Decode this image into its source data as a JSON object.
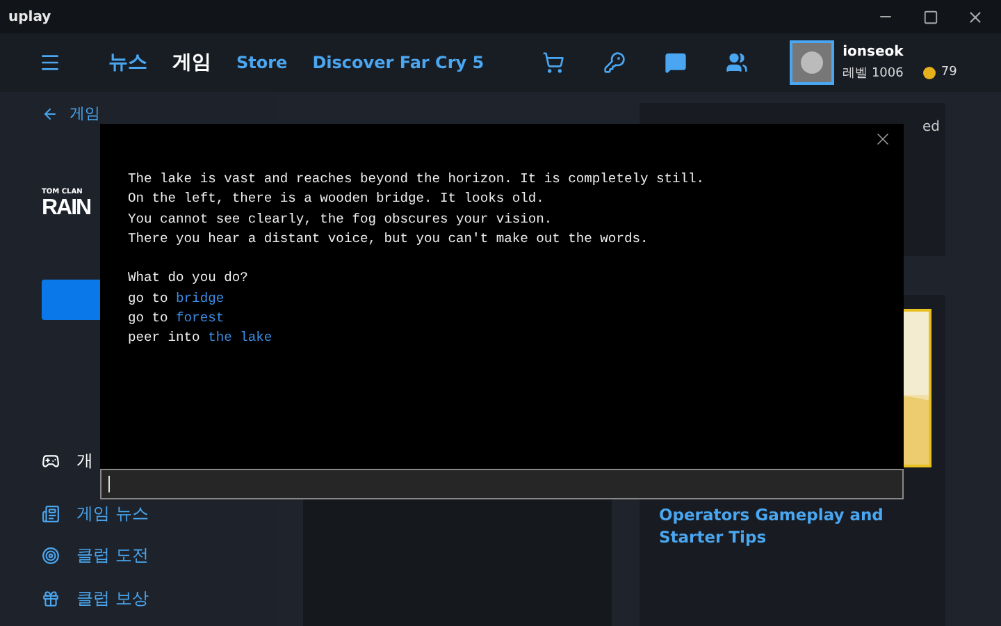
{
  "titlebar": {
    "logo": "uplay"
  },
  "nav": {
    "tabs": [
      {
        "label": "뉴스",
        "selected": false
      },
      {
        "label": "게임",
        "selected": true
      },
      {
        "label": "Store",
        "selected": false
      },
      {
        "label": "Discover Far Cry 5",
        "selected": false
      }
    ],
    "profile": {
      "name": "ionseok",
      "level": "레벨 1006",
      "coins": "79"
    }
  },
  "sidebar": {
    "back": "게임",
    "logo_small": "TOM CLAN",
    "logo_big": "RAIN",
    "items": [
      {
        "kind": "gamepad",
        "label": "개",
        "selected": true
      },
      {
        "kind": "news",
        "label": "게임 뉴스",
        "selected": false
      },
      {
        "kind": "target",
        "label": "클럽 도전",
        "selected": false
      },
      {
        "kind": "gift",
        "label": "클럽 보상",
        "selected": false
      }
    ]
  },
  "right": {
    "card_text": "ed",
    "news_title": "Operators Gameplay and Starter Tips"
  },
  "dialog": {
    "description": [
      "The lake is vast and reaches beyond the horizon. It is completely still.",
      "On the left, there is a wooden bridge. It looks old.",
      "You cannot see clearly, the fog obscures your vision.",
      "There you hear a distant voice, but you can't make out the words."
    ],
    "prompt": "What do you do?",
    "choices": [
      {
        "verb": "go to",
        "target": "bridge"
      },
      {
        "verb": "go to",
        "target": "forest"
      },
      {
        "verb": "peer into",
        "target": "the lake"
      }
    ]
  }
}
